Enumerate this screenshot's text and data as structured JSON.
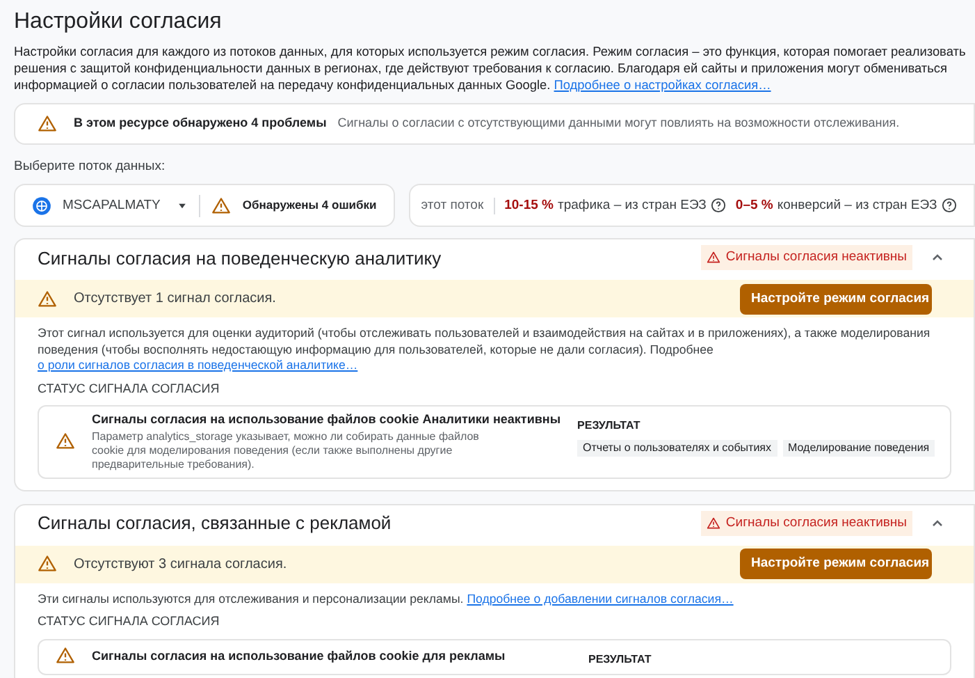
{
  "page_title": "Настройки согласия",
  "intro": {
    "text": "Настройки согласия для каждого из потоков данных, для которых используется режим согласия. Режим согласия – это функция, которая помогает реализовать решения с защитой конфиденциальности данных в регионах, где действуют требования к согласию. Благодаря ей сайты и приложения могут обмениваться информацией о согласии пользователей на передачу конфиденциальных данных Google.",
    "link": "Подробнее о настройках согласия…"
  },
  "issues_banner": {
    "title": "В этом ресурсе обнаружено 4 проблемы",
    "text": "Сигналы о согласии с отсутствующими данными могут повлиять на возможности отслеживания."
  },
  "stream_label": "Выберите поток данных:",
  "stream": {
    "name": "MSCAPALMATY",
    "errors": "Обнаружены 4 ошибки"
  },
  "stats": {
    "label": "этот поток",
    "traffic_value": "10-15 %",
    "traffic_text": "трафика – из стран ЕЭЗ",
    "conversions_value": "0–5 %",
    "conversions_text": "конверсий – из стран ЕЭЗ"
  },
  "sections": [
    {
      "title": "Сигналы согласия на поведенческую аналитику",
      "badge": "Сигналы согласия неактивны",
      "expanded": true,
      "alert": "Отсутствует 1 сигнал согласия.",
      "button": "Настройте режим согласия",
      "description": "Этот сигнал используется для оценки аудиторий (чтобы отслеживать пользователей и взаимодействия на сайтах и в приложениях), а также моделирования поведения (чтобы восполнять недостающую информацию для пользователей, которые не дали согласия). Подробнее",
      "link": "о роли сигналов согласия в поведенческой аналитике…",
      "status_label": "СТАТУС СИГНАЛА СОГЛАСИЯ",
      "signals": [
        {
          "title": "Сигналы согласия на использование файлов cookie Аналитики неактивны",
          "description": "Параметр analytics_storage указывает, можно ли собирать данные файлов cookie для моделирования поведения (если также выполнены другие предварительные требования).",
          "result_label": "РЕЗУЛЬТАТ",
          "results": [
            "Отчеты о пользователях и событиях",
            "Моделирование поведения"
          ]
        }
      ]
    },
    {
      "title": "Сигналы согласия, связанные с рекламой",
      "badge": "Сигналы согласия неактивны",
      "expanded": true,
      "alert": "Отсутствуют 3 сигнала согласия.",
      "button": "Настройте режим согласия",
      "description": "Эти сигналы используются для отслеживания и персонализации рекламы.",
      "link": "Подробнее о добавлении сигналов согласия…",
      "status_label": "СТАТУС СИГНАЛА СОГЛАСИЯ",
      "signals": [
        {
          "title": "Сигналы согласия на использование файлов cookie для рекламы",
          "result_label": "РЕЗУЛЬТАТ"
        }
      ]
    }
  ]
}
